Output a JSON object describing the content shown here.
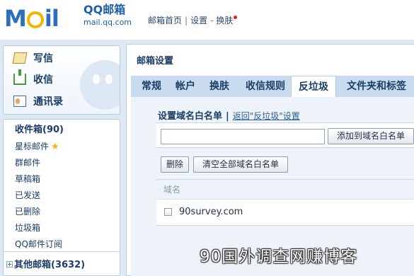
{
  "header": {
    "logo_text": "Mail",
    "brand_name": "QQ邮箱",
    "brand_domain": "mail.qq.com",
    "nav": {
      "home": "邮箱首页",
      "settings": "设置",
      "skin": "换肤"
    }
  },
  "sidebar": {
    "quick": {
      "write": "写信",
      "receive": "收信",
      "contacts": "通讯录"
    },
    "folders": {
      "inbox": "收件箱(90)",
      "starred": "星标邮件",
      "group": "群邮件",
      "drafts": "草稿箱",
      "sent": "已发送",
      "deleted": "已删除",
      "spam": "垃圾箱",
      "subscriptions": "QQ邮件订阅",
      "other": "其他邮箱(3632)"
    }
  },
  "main": {
    "title": "邮箱设置",
    "tabs": [
      {
        "label": "常规"
      },
      {
        "label": "帐户"
      },
      {
        "label": "换肤"
      },
      {
        "label": "收信规则"
      },
      {
        "label": "反垃圾"
      },
      {
        "label": "文件夹和标签"
      }
    ],
    "active_tab": "反垃圾",
    "section_title": "设置域名白名单",
    "back_link": "返回\"反垃圾\"设置",
    "domain_input": {
      "value": "",
      "placeholder": ""
    },
    "add_button": "添加到域名白名单",
    "delete_button": "删除",
    "clear_button": "清空全部域名白名单",
    "list_header": "域名",
    "list_items": [
      {
        "domain": "90survey.com"
      }
    ]
  },
  "watermark": "90国外调查网赚博客"
}
